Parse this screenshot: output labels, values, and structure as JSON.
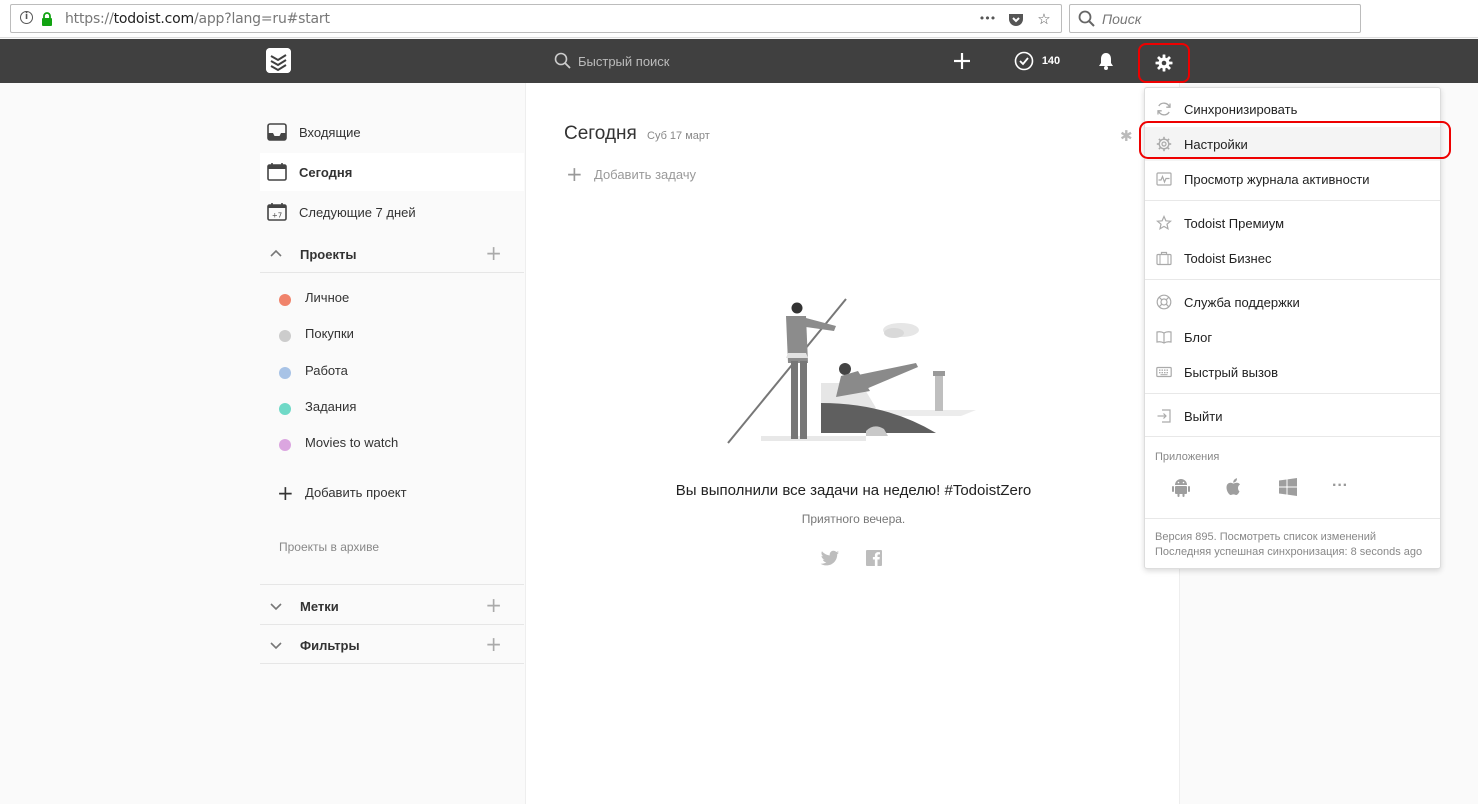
{
  "browser": {
    "url_prefix": "https://",
    "url_host": "todoist.com",
    "url_path": "/app?lang=ru#start",
    "search_placeholder": "Поиск",
    "menu_glyph": "•••"
  },
  "topbar": {
    "quick_search_placeholder": "Быстрый поиск",
    "karma_count": "140"
  },
  "sidebar": {
    "nav": [
      {
        "label": "Входящие"
      },
      {
        "label": "Сегодня"
      },
      {
        "label": "Следующие 7 дней",
        "badge": "+7"
      }
    ],
    "projects_title": "Проекты",
    "projects": [
      {
        "label": "Личное",
        "color": "#f0836b"
      },
      {
        "label": "Покупки",
        "color": "#cccccc"
      },
      {
        "label": "Работа",
        "color": "#a8c3e6"
      },
      {
        "label": "Задания",
        "color": "#6fd9c7"
      },
      {
        "label": "Movies to watch",
        "color": "#dba6e0"
      }
    ],
    "add_project": "Добавить проект",
    "archive": "Проекты в архиве",
    "labels_title": "Метки",
    "filters_title": "Фильтры"
  },
  "main": {
    "title": "Сегодня",
    "date": "Суб 17 март",
    "add_task": "Добавить задачу",
    "zero_message": "Вы выполнили все задачи на неделю! #TodoistZero",
    "zero_sub": "Приятного вечера."
  },
  "settings_menu": {
    "items": [
      {
        "label": "Синхронизировать"
      },
      {
        "label": "Настройки"
      },
      {
        "label": "Просмотр журнала активности"
      },
      {
        "label": "Todoist Премиум"
      },
      {
        "label": "Todoist Бизнес"
      },
      {
        "label": "Служба поддержки"
      },
      {
        "label": "Блог"
      },
      {
        "label": "Быстрый вызов"
      },
      {
        "label": "Выйти"
      }
    ],
    "apps_label": "Приложения",
    "more_apps": "···",
    "version_line": "Версия 895. Посмотреть список изменений",
    "sync_line": "Последняя успешная синхронизация: 8 seconds ago"
  },
  "colors": {
    "topbar": "#404040",
    "highlight_ring": "#ee0000",
    "lock_green": "#12a312"
  }
}
